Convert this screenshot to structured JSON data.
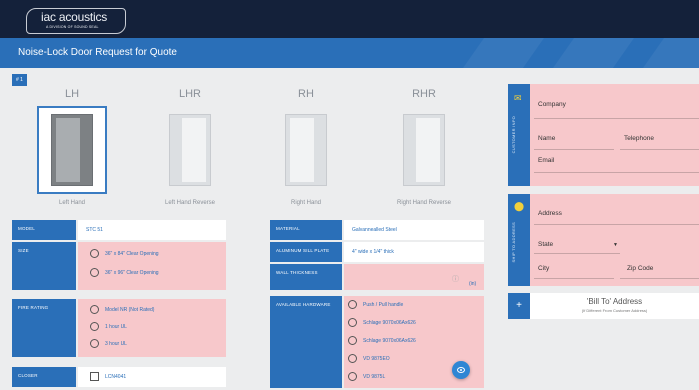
{
  "header": {
    "logo_main": "iac acoustics",
    "logo_sub": "A DIVISION OF SOUND SEAL"
  },
  "page_title": "Noise-Lock Door Request for Quote",
  "item_index": "# 1",
  "doors": [
    {
      "title": "LH",
      "caption": "Left Hand",
      "selected": true
    },
    {
      "title": "LHR",
      "caption": "Left Hand Reverse",
      "selected": false
    },
    {
      "title": "RH",
      "caption": "Right Hand",
      "selected": false
    },
    {
      "title": "RHR",
      "caption": "Right Hand Reverse",
      "selected": false
    }
  ],
  "left_form": {
    "model": {
      "label": "MODEL",
      "value": "STC 51"
    },
    "size": {
      "label": "SIZE",
      "options": [
        "36\" x 84\" Clear Opening",
        "36\" x 96\" Clear Opening"
      ]
    },
    "fire_rating": {
      "label": "FIRE RATING",
      "options": [
        "Model NR (Not Rated)",
        "1 hour UL",
        "3 hour UL"
      ]
    },
    "closer": {
      "label": "CLOSER",
      "value": "LCN4041"
    }
  },
  "mid_form": {
    "material": {
      "label": "MATERIAL",
      "value": "Galvannealled Steel"
    },
    "sill_plate": {
      "label": "ALUMINUM SILL PLATE",
      "value": "4\" wide x 1/4\" thick"
    },
    "wall_thickness": {
      "label": "WALL THICKNESS",
      "unit": "(in)"
    },
    "hardware": {
      "label": "AVAILABLE HARDWARE",
      "options": [
        "Push / Pull handle",
        "Schlage 9070x06Ax626",
        "Schlage 9070x06Ax626",
        "VD 9875EO",
        "VD 9875L"
      ]
    }
  },
  "customer_info": {
    "section": "CUSTOMER INFO",
    "company": "Company",
    "name": "Name",
    "telephone": "Telephone",
    "email": "Email"
  },
  "ship_to": {
    "section": "SHIP TO ADDRESS",
    "address": "Address",
    "state": "State",
    "city": "City",
    "zip": "Zip Code"
  },
  "bill_to": {
    "title": "'Bill To' Address",
    "subtitle": "(If Different From Customer Address)"
  },
  "icons": {
    "envelope": "envelope-icon",
    "pin": "map-pin-icon",
    "plus": "plus-icon",
    "eye": "eye-icon",
    "info": "info-icon"
  },
  "colors": {
    "brand_blue": "#2a6fb8",
    "dark_navy": "#14213a",
    "required_pink": "#f7c8cb",
    "pin_yellow": "#f1d03c"
  }
}
